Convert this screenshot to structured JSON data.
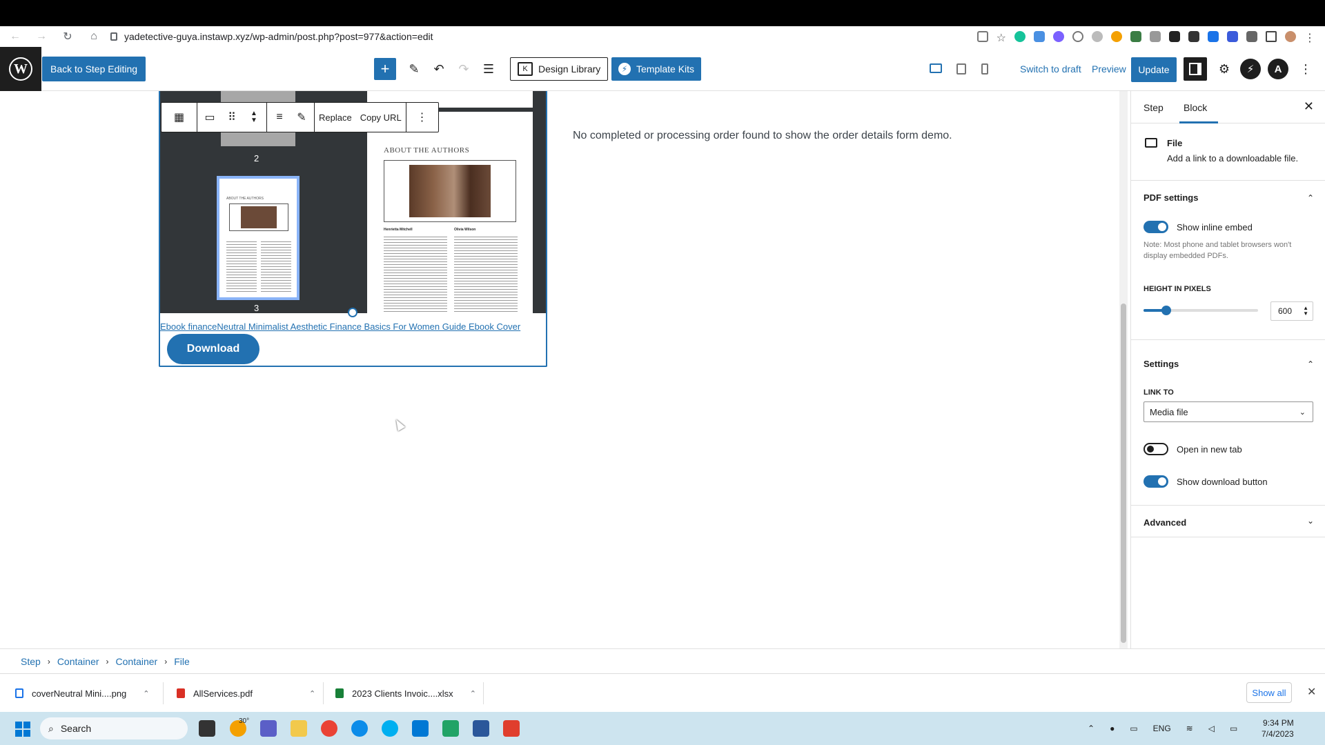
{
  "browser": {
    "url": "yadetective-guya.instawp.xyz/wp-admin/post.php?post=977&action=edit"
  },
  "editor": {
    "back_label": "Back to Step Editing",
    "design_library": "Design Library",
    "template_kits": "Template Kits",
    "switch_to_draft": "Switch to draft",
    "preview": "Preview",
    "update": "Update"
  },
  "block_toolbar": {
    "replace": "Replace",
    "copy_url": "Copy URL"
  },
  "pdf": {
    "thumb_page_2": "2",
    "thumb_page_3": "3",
    "page_title": "ABOUT THE AUTHORS",
    "name_1": "Henrietta Mitchell",
    "name_2": "Olivia Wilson",
    "mini_title": "ABOUT THE AUTHORS"
  },
  "file_block": {
    "link_text": "Ebook financeNeutral Minimalist Aesthetic Finance Basics For Women Guide Ebook Cover",
    "download_label": "Download"
  },
  "content": {
    "order_message": "No completed or processing order found to show the order details form demo."
  },
  "sidebar": {
    "tab_step": "Step",
    "tab_block": "Block",
    "block_name": "File",
    "block_desc": "Add a link to a downloadable file.",
    "pdf_settings": "PDF settings",
    "show_inline_embed": "Show inline embed",
    "show_inline_embed_on": true,
    "note": "Note: Most phone and tablet browsers won't display embedded PDFs.",
    "height_label": "HEIGHT IN PIXELS",
    "height_value": "600",
    "height_fraction": 0.2,
    "settings": "Settings",
    "link_to_label": "LINK TO",
    "link_to_value": "Media file",
    "open_new_tab": "Open in new tab",
    "open_new_tab_on": false,
    "show_download_button": "Show download button",
    "show_download_button_on": true,
    "advanced": "Advanced"
  },
  "breadcrumb": [
    "Step",
    "Container",
    "Container",
    "File"
  ],
  "downloads": {
    "items": [
      "coverNeutral Mini....png",
      "AllServices.pdf",
      "2023 Clients Invoic....xlsx"
    ],
    "show_all": "Show all"
  },
  "taskbar": {
    "search": "Search",
    "weather": "30°",
    "lang": "ENG",
    "time": "9:34 PM",
    "date": "7/4/2023"
  }
}
